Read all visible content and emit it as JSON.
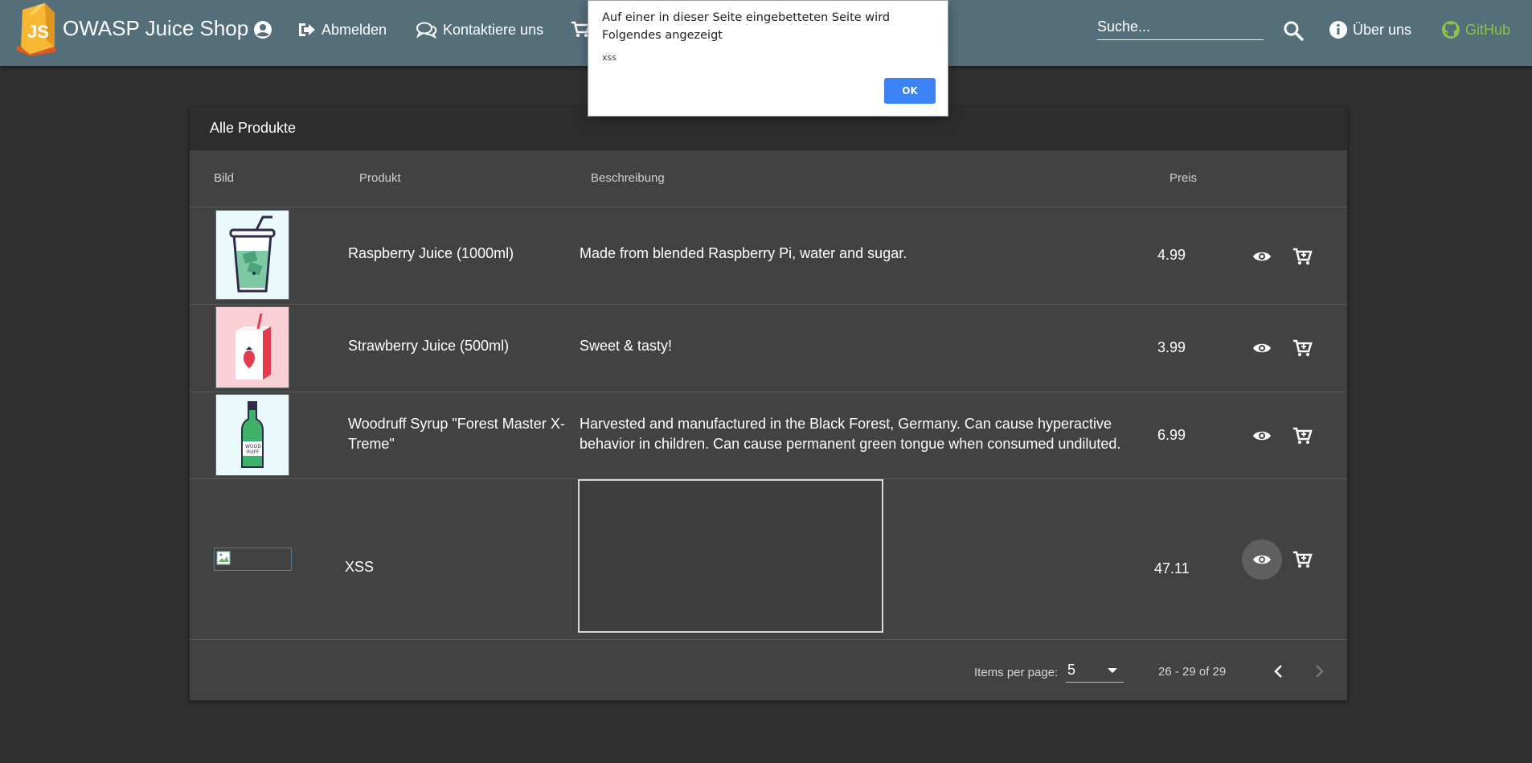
{
  "app": {
    "title": "OWASP Juice Shop",
    "logo_text": "JS"
  },
  "nav": {
    "logout_label": "Abmelden",
    "contact_label": "Kontaktiere uns",
    "about_label": "Über uns",
    "github_label": "GitHub"
  },
  "search": {
    "placeholder": "Suche..."
  },
  "alert": {
    "message": "Auf einer in dieser Seite eingebetteten Seite wird Folgendes angezeigt",
    "text": "xss",
    "ok_label": "OK"
  },
  "table": {
    "title": "Alle Produkte",
    "columns": [
      "Bild",
      "Produkt",
      "Beschreibung",
      "Preis"
    ],
    "rows": [
      {
        "name": "Raspberry Juice (1000ml)",
        "description": "Made from blended Raspberry Pi, water and sugar.",
        "price": "4.99",
        "image_icon": "raspberry-juice-cup-icon"
      },
      {
        "name": "Strawberry Juice (500ml)",
        "description": "Sweet & tasty!",
        "price": "3.99",
        "image_icon": "strawberry-juice-box-icon"
      },
      {
        "name": "Woodruff Syrup \"Forest Master X-Treme\"",
        "description": "Harvested and manufactured in the Black Forest, Germany. Can cause hyperactive behavior in children. Can cause permanent green tongue when consumed undiluted.",
        "price": "6.99",
        "image_icon": "woodruff-syrup-bottle-icon"
      },
      {
        "name": "XSS",
        "description": "",
        "price": "47.11",
        "image_icon": "broken-image-icon"
      }
    ]
  },
  "paginator": {
    "items_per_page_label": "Items per page:",
    "page_size": "5",
    "range_label": "26 - 29 of 29"
  },
  "colors": {
    "toolbar": "#546e7a",
    "background": "#303030",
    "card": "#424242",
    "card_header": "#2d2d2d",
    "github": "#8bc34a",
    "alert_button": "#3b82f6"
  }
}
